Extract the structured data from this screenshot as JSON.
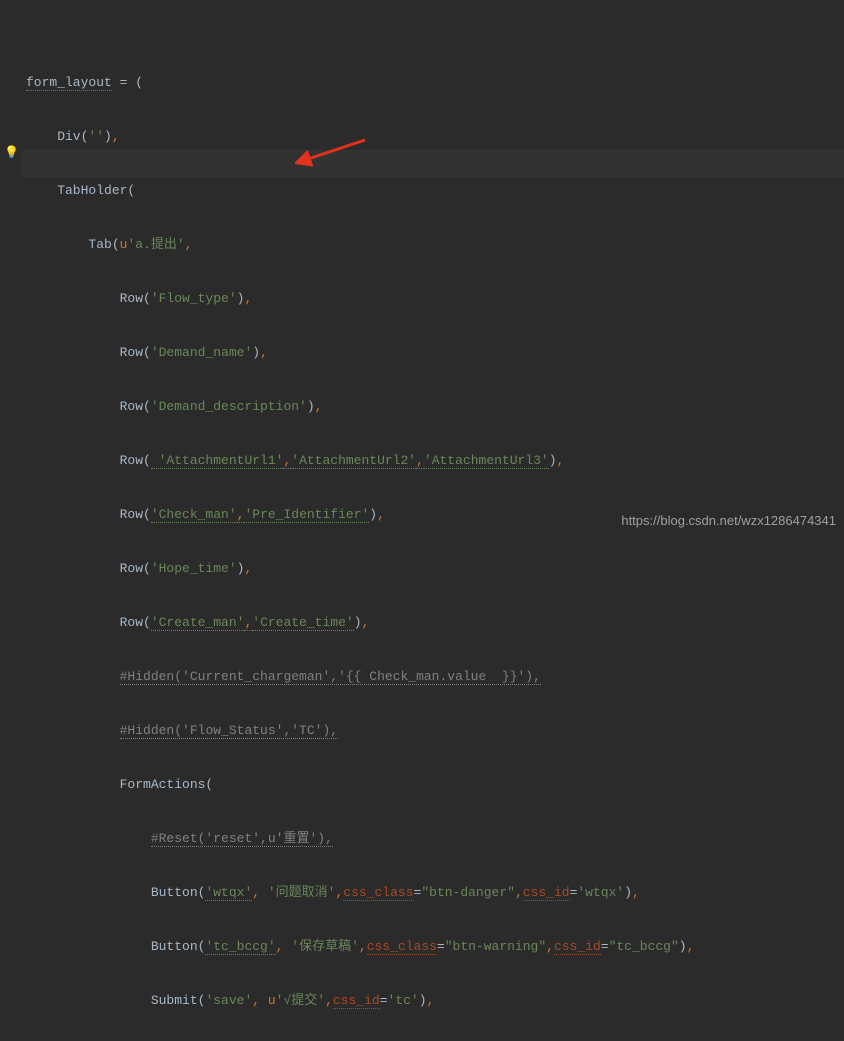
{
  "gutter": {
    "bulb": "💡"
  },
  "watermark": "https://blog.csdn.net/wzx1286474341",
  "code": {
    "l1": {
      "a": "form_layout",
      "b": " = ("
    },
    "l2": {
      "a": "    Div(",
      "b": "''",
      "c": ")",
      "d": ","
    },
    "l3": {
      "a": "    TabHolder("
    },
    "l4": {
      "a": "        Tab(",
      "u": "u",
      "b": "'a.提出'",
      "c": ","
    },
    "l5": {
      "a": "            Row(",
      "b": "'Flow_type'",
      "c": ")",
      "d": ","
    },
    "l6": {
      "a": "            Row(",
      "b": "'Demand_name'",
      "c": ")",
      "d": ","
    },
    "l7": {
      "a": "            Row(",
      "b": "'Demand_description'",
      "c": ")",
      "d": ","
    },
    "l8": {
      "a": "            Row(",
      "b1": " 'AttachmentUrl1'",
      "c1": ",",
      "b2": "'AttachmentUrl2'",
      "c2": ",",
      "b3": "'AttachmentUrl3'",
      "c3": ")",
      "d": ","
    },
    "l9": {
      "a": "            Row(",
      "b1": "'Check_man'",
      "c1": ",",
      "b2": "'Pre_Identifier'",
      "c3": ")",
      "d": ","
    },
    "l10": {
      "a": "            Row(",
      "b": "'Hope_time'",
      "c": ")",
      "d": ","
    },
    "l11": {
      "a": "            Row(",
      "b1": "'Create_man'",
      "c1": ",",
      "b2": "'Create_time'",
      "c3": ")",
      "d": ","
    },
    "l12": {
      "a": "            ",
      "b": "#Hidden('Current_chargeman','{{ Check_man.value  }}'),"
    },
    "l13": {
      "a": "            ",
      "b": "#Hidden('Flow_Status','TC'),"
    },
    "l14": {
      "a": "            FormActions("
    },
    "l15": {
      "a": "                ",
      "b": "#Reset('reset',u'重置'),"
    },
    "l16": {
      "a": "                Button(",
      "b1": "'wtqx'",
      "c1": ", ",
      "b2": "'问题取消'",
      "c2": ",",
      "p1": "css_class",
      "e1": "=",
      "v1": "\"btn-danger\"",
      "c3": ",",
      "p2": "css_id",
      "e2": "=",
      "v2": "'wtqx'",
      "c4": ")",
      "d": ","
    },
    "l17": {
      "a": "                Button(",
      "b1": "'tc_bccg'",
      "c1": ", ",
      "b2": "'保存草稿'",
      "c2": ",",
      "p1": "css_class",
      "e1": "=",
      "v1": "\"btn-warning\"",
      "c3": ",",
      "p2": "css_id",
      "e2": "=",
      "v2": "\"tc_bccg\"",
      "c4": ")",
      "d": ","
    },
    "l18": {
      "a": "                Submit(",
      "b1": "'save'",
      "c1": ", ",
      "u": "u",
      "b2": "'√提交'",
      "c2": ",",
      "p1": "css_id",
      "e1": "=",
      "v1": "'tc'",
      "c3": ")",
      "d": ","
    }
  }
}
